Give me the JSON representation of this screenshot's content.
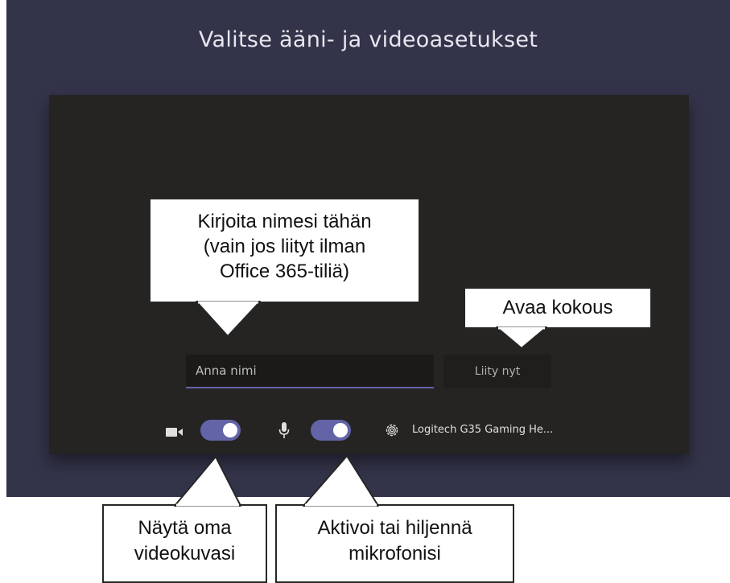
{
  "dialog": {
    "title": "Valitse ääni- ja videoasetukset",
    "name_placeholder": "Anna nimi",
    "join_label": "Liity nyt",
    "device_label": "Logitech G35 Gaming He...",
    "camera_on": true,
    "mic_on": true
  },
  "callouts": {
    "name_line1": "Kirjoita nimesi tähän",
    "name_line2": "(vain jos liityt ilman",
    "name_line3": "Office 365-tiliä)",
    "join": "Avaa kokous",
    "video_line1": "Näytä oma",
    "video_line2": "videokuvasi",
    "mic_line1": "Aktivoi tai hiljennä",
    "mic_line2": "mikrofonisi"
  },
  "colors": {
    "accent": "#6264a7",
    "background": "#33344a",
    "panel": "#252423"
  },
  "icons": [
    "video-camera-icon",
    "microphone-icon",
    "gear-icon"
  ]
}
